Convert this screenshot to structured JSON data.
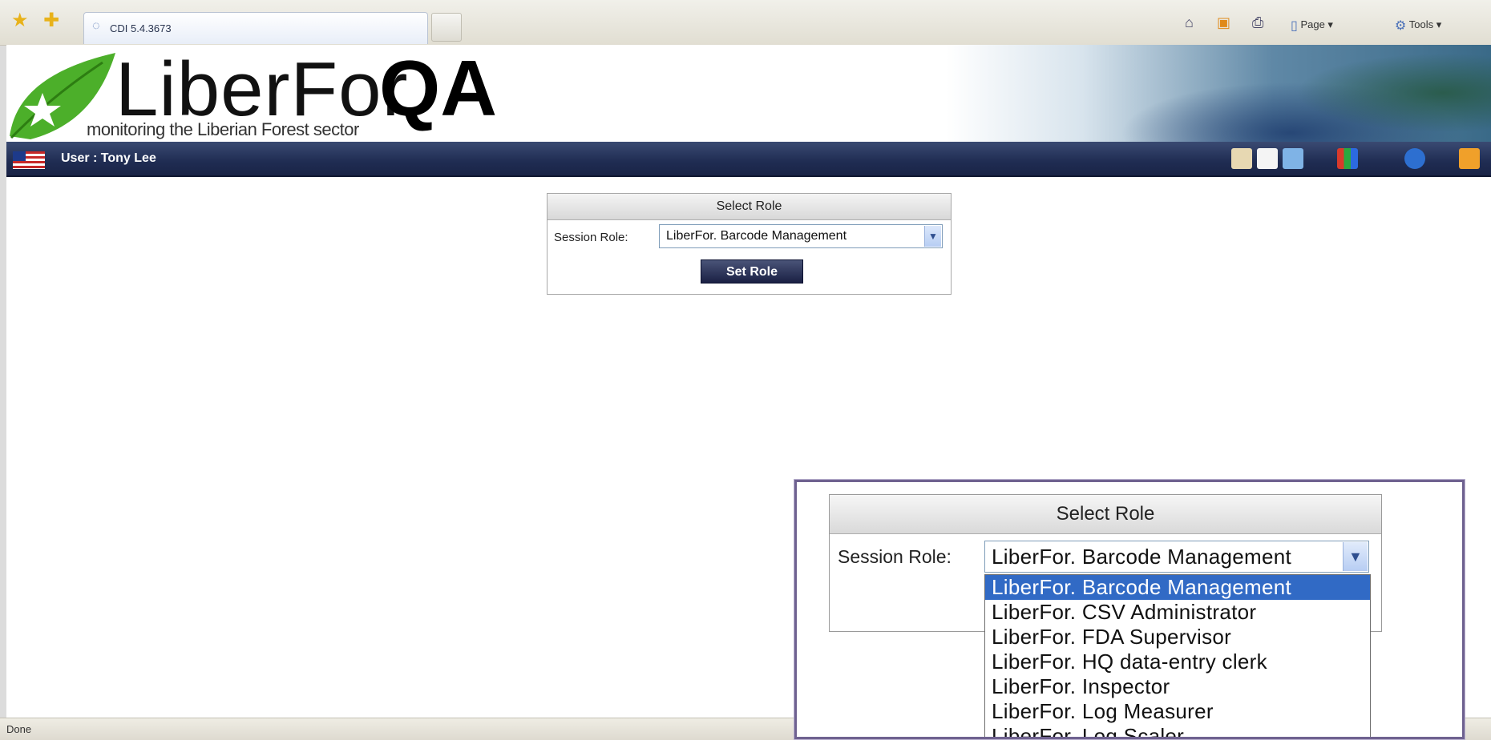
{
  "browser": {
    "tab_title": "CDI 5.4.3673",
    "commands": {
      "page": "Page",
      "tools": "Tools"
    }
  },
  "banner": {
    "logo_main": "LiberFor",
    "logo_bold": "QA",
    "tagline": "monitoring the Liberian Forest sector"
  },
  "navbar": {
    "user": "User : Tony Lee"
  },
  "role_panel": {
    "title": "Select Role",
    "session_role_label": "Session Role:",
    "selected_role": "LiberFor. Barcode Management",
    "button": "Set Role"
  },
  "zoom_panel": {
    "title": "Select Role",
    "session_role_label": "Session Role:",
    "selected_role": "LiberFor. Barcode Management",
    "options": [
      "LiberFor. Barcode Management",
      "LiberFor. CSV Administrator",
      "LiberFor. FDA Supervisor",
      "LiberFor. HQ data-entry clerk",
      "LiberFor. Inspector",
      "LiberFor. Log Measurer",
      "LiberFor. Log Scaler"
    ],
    "selected_index": 0
  },
  "statusbar": {
    "text": "Done"
  },
  "colors": {
    "nav_bar": "#1f2c52",
    "selection": "#316ac5",
    "leaf_green": "#4caf2a"
  },
  "icons": {
    "toolbar": [
      "favorites-star-icon",
      "add-favorites-icon",
      "home-icon",
      "feeds-icon",
      "print-icon",
      "page-icon",
      "tools-icon"
    ],
    "navbar": [
      "home-icon",
      "book-icon",
      "map-icon",
      "people-icon",
      "info-icon",
      "exit-icon"
    ]
  }
}
